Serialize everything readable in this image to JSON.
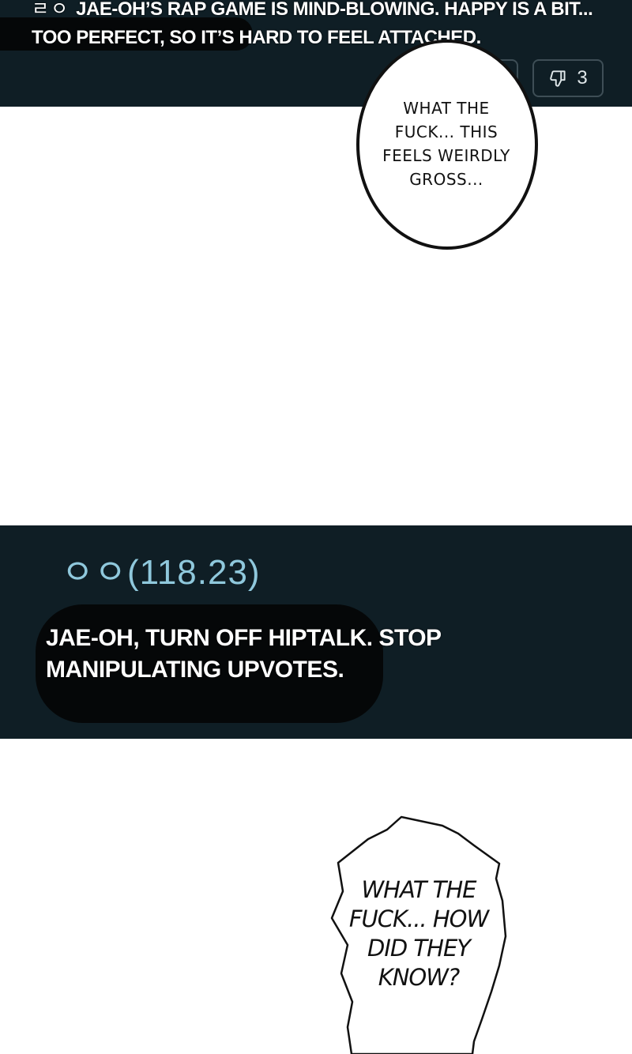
{
  "top_comment": {
    "prefix": "ㄹㅇ",
    "text": "Jae-oh’s rap game is mind-blowing. Happy is a bit... too perfect, so it’s hard to feel attached.",
    "dislike_count": "3"
  },
  "bubble_1": {
    "text": "WHAT THE FUCK... THIS FEELS WEIRDLY GROSS..."
  },
  "mid_comment": {
    "username": "ㅇㅇ(118.23)",
    "text": "Jae-oh, turn off HipTalk. Stop manipulating upvotes."
  },
  "bubble_2": {
    "text": "WHAT THE FUCK... HOW DID THEY KNOW?"
  },
  "icons": [
    "thumbs-down-icon"
  ],
  "colors": {
    "panel_bg": "#0f1e25",
    "username": "#8fc8dc",
    "text": "#ffffff"
  }
}
